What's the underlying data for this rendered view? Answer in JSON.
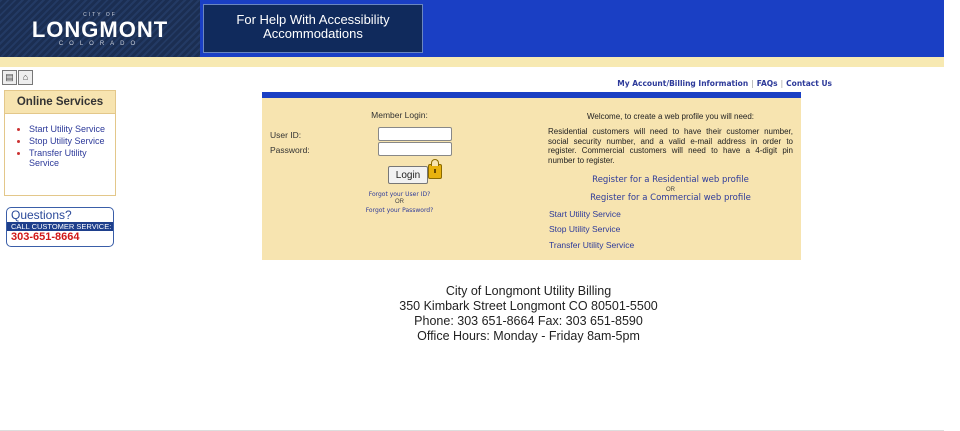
{
  "header": {
    "logo": {
      "small": "CITY OF",
      "main": "LONGMONT",
      "sub": "COLORADO"
    },
    "help_text": "For Help With Accessibility Accommodations"
  },
  "colors": {
    "header_blue": "#1a3fc4",
    "panel_tan": "#f7e4b0",
    "link_blue": "#2d3a9a",
    "phone_red": "#d01818"
  },
  "toolbar": {
    "icons": [
      "page-icon",
      "home-icon"
    ]
  },
  "sidebar": {
    "title": "Online Services",
    "items": [
      "Start Utility Service",
      "Stop Utility Service",
      "Transfer Utility Service"
    ]
  },
  "questions": {
    "title": "Questions?",
    "band": "CALL CUSTOMER SERVICE:",
    "phone": "303-651-8664"
  },
  "top_links": [
    "My Account/Billing Information",
    "FAQs",
    "Contact Us"
  ],
  "login": {
    "heading": "Member Login:",
    "user_label": "User ID:",
    "password_label": "Password:",
    "user_value": "",
    "password_value": "",
    "button": "Login",
    "forgot_user": "Forgot your User ID?",
    "or": "OR",
    "forgot_password": "Forgot your Password?"
  },
  "register": {
    "welcome": "Welcome, to create a web profile you will need:",
    "description": "Residential customers will need to have their customer number, social security number, and a valid e-mail address in order to register. Commercial customers will need to have a 4-digit pin number to register.",
    "residential": "Register for a Residential web profile",
    "or": "OR",
    "commercial": "Register for a Commercial web profile",
    "links": [
      "Start Utility Service",
      "Stop Utility Service",
      "Transfer Utility Service"
    ]
  },
  "footer": {
    "line1": "City of Longmont Utility Billing",
    "line2": "350 Kimbark Street Longmont CO 80501-5500",
    "line3": "Phone: 303 651-8664 Fax: 303 651-8590",
    "line4": "Office Hours: Monday - Friday 8am-5pm"
  }
}
